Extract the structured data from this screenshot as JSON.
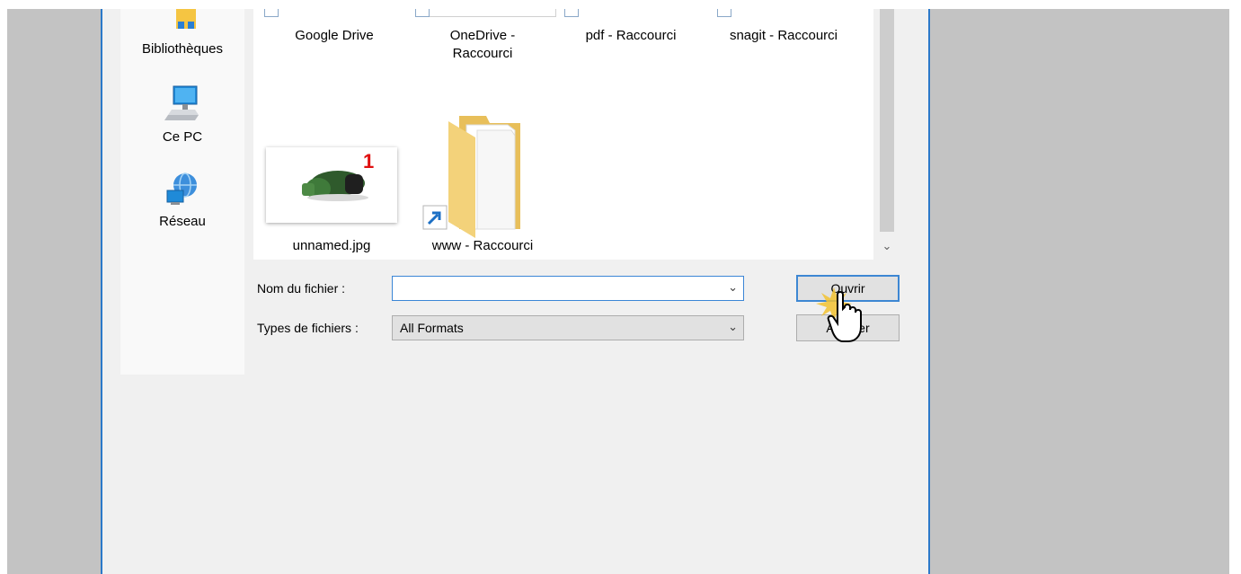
{
  "nav_pane": {
    "items": [
      {
        "label": "Bibliothèques",
        "icon": "libraries-icon"
      },
      {
        "label": "Ce PC",
        "icon": "computer-icon"
      },
      {
        "label": "Réseau",
        "icon": "network-icon"
      }
    ]
  },
  "files": [
    {
      "name": "Google Drive",
      "icon": "shortcut-icon"
    },
    {
      "name_line1": "OneDrive -",
      "name_line2": "Raccourci",
      "icon": "shortcut-icon"
    },
    {
      "name": "pdf - Raccourci",
      "icon": "shortcut-icon"
    },
    {
      "name": "snagit - Raccourci",
      "icon": "shortcut-icon"
    },
    {
      "name": "unnamed.jpg",
      "icon": "image-thumbnail",
      "badge": "1"
    },
    {
      "name": "www - Raccourci",
      "icon": "folder-shortcut-icon"
    }
  ],
  "form": {
    "filename_label": "Nom du fichier :",
    "filename_value": "",
    "filetype_label": "Types de fichiers :",
    "filetype_value": "All Formats"
  },
  "buttons": {
    "open": "Ouvrir",
    "cancel": "Annuler"
  },
  "colors": {
    "accent": "#2b79c9",
    "badge": "#e01010",
    "folder": "#f3d27a"
  }
}
